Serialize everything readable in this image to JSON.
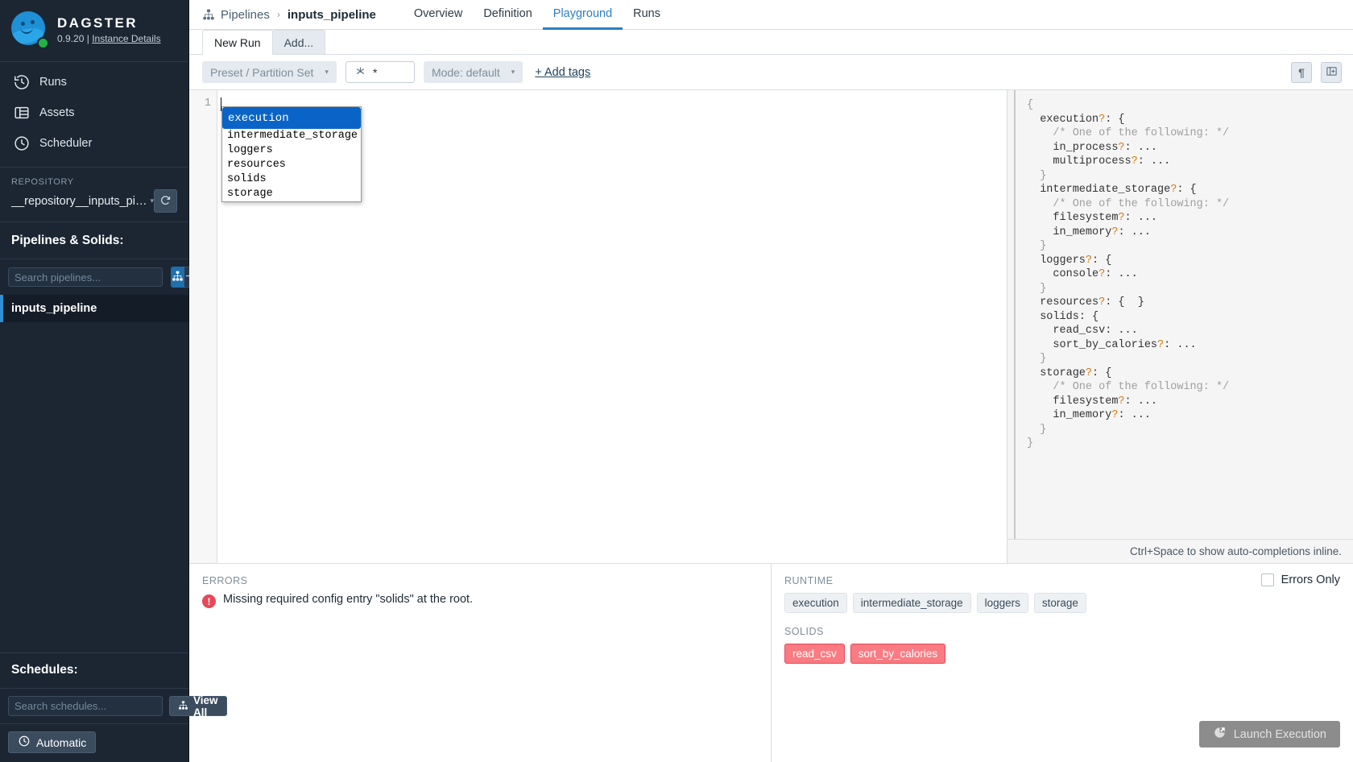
{
  "sidebar": {
    "brand": {
      "title": "DAGSTER",
      "version": "0.9.20",
      "separator": "|",
      "instance_link": "Instance Details"
    },
    "nav": [
      {
        "label": "Runs",
        "icon": "history-icon"
      },
      {
        "label": "Assets",
        "icon": "table-icon"
      },
      {
        "label": "Scheduler",
        "icon": "clock-icon"
      }
    ],
    "repository": {
      "label": "REPOSITORY",
      "name": "__repository__inputs_pipeline",
      "caret": "▾",
      "reload_icon": "refresh-icon"
    },
    "pipelines_section": {
      "heading": "Pipelines & Solids:",
      "search_placeholder": "Search pipelines...",
      "search_value": "",
      "toggle_pipelines_icon": "hierarchy-icon",
      "toggle_solids_icon": "node-icon",
      "items": [
        {
          "label": "inputs_pipeline",
          "selected": true
        }
      ]
    },
    "schedules_section": {
      "heading": "Schedules:",
      "search_placeholder": "Search schedules...",
      "search_value": "",
      "view_all_label": "View All",
      "view_all_icon": "hierarchy-icon"
    },
    "footer": {
      "automatic_label": "Automatic",
      "automatic_icon": "clock-icon"
    }
  },
  "topbar": {
    "breadcrumb_icon": "hierarchy-icon",
    "breadcrumb_root": "Pipelines",
    "breadcrumb_sep": "›",
    "breadcrumb_current": "inputs_pipeline",
    "tabs": [
      {
        "label": "Overview",
        "active": false
      },
      {
        "label": "Definition",
        "active": false
      },
      {
        "label": "Playground",
        "active": true
      },
      {
        "label": "Runs",
        "active": false
      }
    ],
    "accent_color": "#2a7fc4"
  },
  "run_tabs": [
    {
      "label": "New Run",
      "active": true
    },
    {
      "label": "Add...",
      "active": false
    }
  ],
  "config_bar": {
    "preset_label": "Preset / Partition Set",
    "preset_caret": "▾",
    "solid_selection_icon": "solid-selection-icon",
    "solid_selection_value": "*",
    "mode_label": "Mode: default",
    "mode_caret": "▾",
    "add_tags_label": "+ Add tags",
    "right_buttons": [
      {
        "icon": "pilcrow-icon",
        "glyph": "¶"
      },
      {
        "icon": "split-panel-icon",
        "glyph": ""
      }
    ]
  },
  "editor": {
    "line_numbers": [
      "1"
    ],
    "content": "",
    "autocomplete": {
      "items": [
        {
          "label": "execution",
          "selected": true
        },
        {
          "label": "intermediate_storage",
          "selected": false
        },
        {
          "label": "loggers",
          "selected": false
        },
        {
          "label": "resources",
          "selected": false
        },
        {
          "label": "solids",
          "selected": false
        },
        {
          "label": "storage",
          "selected": false
        }
      ]
    }
  },
  "doc_panel": {
    "hint": "Ctrl+Space to show auto-completions inline.",
    "lines": [
      [
        {
          "t": "{",
          "c": "br"
        }
      ],
      [
        {
          "t": "  execution",
          "c": ""
        },
        {
          "t": "?",
          "c": "q"
        },
        {
          "t": ": {",
          "c": ""
        }
      ],
      [
        {
          "t": "    /* One of the following: */",
          "c": "cm"
        }
      ],
      [
        {
          "t": "    in_process",
          "c": ""
        },
        {
          "t": "?",
          "c": "q"
        },
        {
          "t": ": ...",
          "c": ""
        }
      ],
      [
        {
          "t": "    multiprocess",
          "c": ""
        },
        {
          "t": "?",
          "c": "q"
        },
        {
          "t": ": ...",
          "c": ""
        }
      ],
      [
        {
          "t": "  }",
          "c": "br"
        }
      ],
      [
        {
          "t": "  intermediate_storage",
          "c": ""
        },
        {
          "t": "?",
          "c": "q"
        },
        {
          "t": ": {",
          "c": ""
        }
      ],
      [
        {
          "t": "    /* One of the following: */",
          "c": "cm"
        }
      ],
      [
        {
          "t": "    filesystem",
          "c": ""
        },
        {
          "t": "?",
          "c": "q"
        },
        {
          "t": ": ...",
          "c": ""
        }
      ],
      [
        {
          "t": "    in_memory",
          "c": ""
        },
        {
          "t": "?",
          "c": "q"
        },
        {
          "t": ": ...",
          "c": ""
        }
      ],
      [
        {
          "t": "  }",
          "c": "br"
        }
      ],
      [
        {
          "t": "  loggers",
          "c": ""
        },
        {
          "t": "?",
          "c": "q"
        },
        {
          "t": ": {",
          "c": ""
        }
      ],
      [
        {
          "t": "    console",
          "c": ""
        },
        {
          "t": "?",
          "c": "q"
        },
        {
          "t": ": ...",
          "c": ""
        }
      ],
      [
        {
          "t": "  }",
          "c": "br"
        }
      ],
      [
        {
          "t": "  resources",
          "c": ""
        },
        {
          "t": "?",
          "c": "q"
        },
        {
          "t": ": {  }",
          "c": ""
        }
      ],
      [
        {
          "t": "  solids: {",
          "c": ""
        }
      ],
      [
        {
          "t": "    read_csv: ...",
          "c": ""
        }
      ],
      [
        {
          "t": "    sort_by_calories",
          "c": ""
        },
        {
          "t": "?",
          "c": "q"
        },
        {
          "t": ": ...",
          "c": ""
        }
      ],
      [
        {
          "t": "  }",
          "c": "br"
        }
      ],
      [
        {
          "t": "  storage",
          "c": ""
        },
        {
          "t": "?",
          "c": "q"
        },
        {
          "t": ": {",
          "c": ""
        }
      ],
      [
        {
          "t": "    /* One of the following: */",
          "c": "cm"
        }
      ],
      [
        {
          "t": "    filesystem",
          "c": ""
        },
        {
          "t": "?",
          "c": "q"
        },
        {
          "t": ": ...",
          "c": ""
        }
      ],
      [
        {
          "t": "    in_memory",
          "c": ""
        },
        {
          "t": "?",
          "c": "q"
        },
        {
          "t": ": ...",
          "c": ""
        }
      ],
      [
        {
          "t": "  }",
          "c": "br"
        }
      ],
      [
        {
          "t": "}",
          "c": "br"
        }
      ]
    ]
  },
  "bottom": {
    "errors": {
      "label": "ERRORS",
      "items": [
        {
          "icon": "error-icon",
          "message": "Missing required config entry \"solids\" at the root."
        }
      ]
    },
    "runtime": {
      "label": "RUNTIME",
      "tags": [
        {
          "label": "execution",
          "state": "ok"
        },
        {
          "label": "intermediate_storage",
          "state": "ok"
        },
        {
          "label": "loggers",
          "state": "ok"
        },
        {
          "label": "storage",
          "state": "ok"
        }
      ]
    },
    "solids": {
      "label": "SOLIDS",
      "tags": [
        {
          "label": "read_csv",
          "state": "error"
        },
        {
          "label": "sort_by_calories",
          "state": "error"
        }
      ]
    },
    "errors_only": {
      "label": "Errors Only",
      "checked": false
    },
    "launch": {
      "label": "Launch Execution",
      "icon": "rocket-icon",
      "disabled": true
    }
  },
  "colors": {
    "sidebar_bg": "#1b2632",
    "accent": "#2a7fc4",
    "error": "#e8485a",
    "error_tag": "#fa7b82",
    "autocomplete_selected": "#0a64c8",
    "optional_marker": "#d97b12"
  }
}
